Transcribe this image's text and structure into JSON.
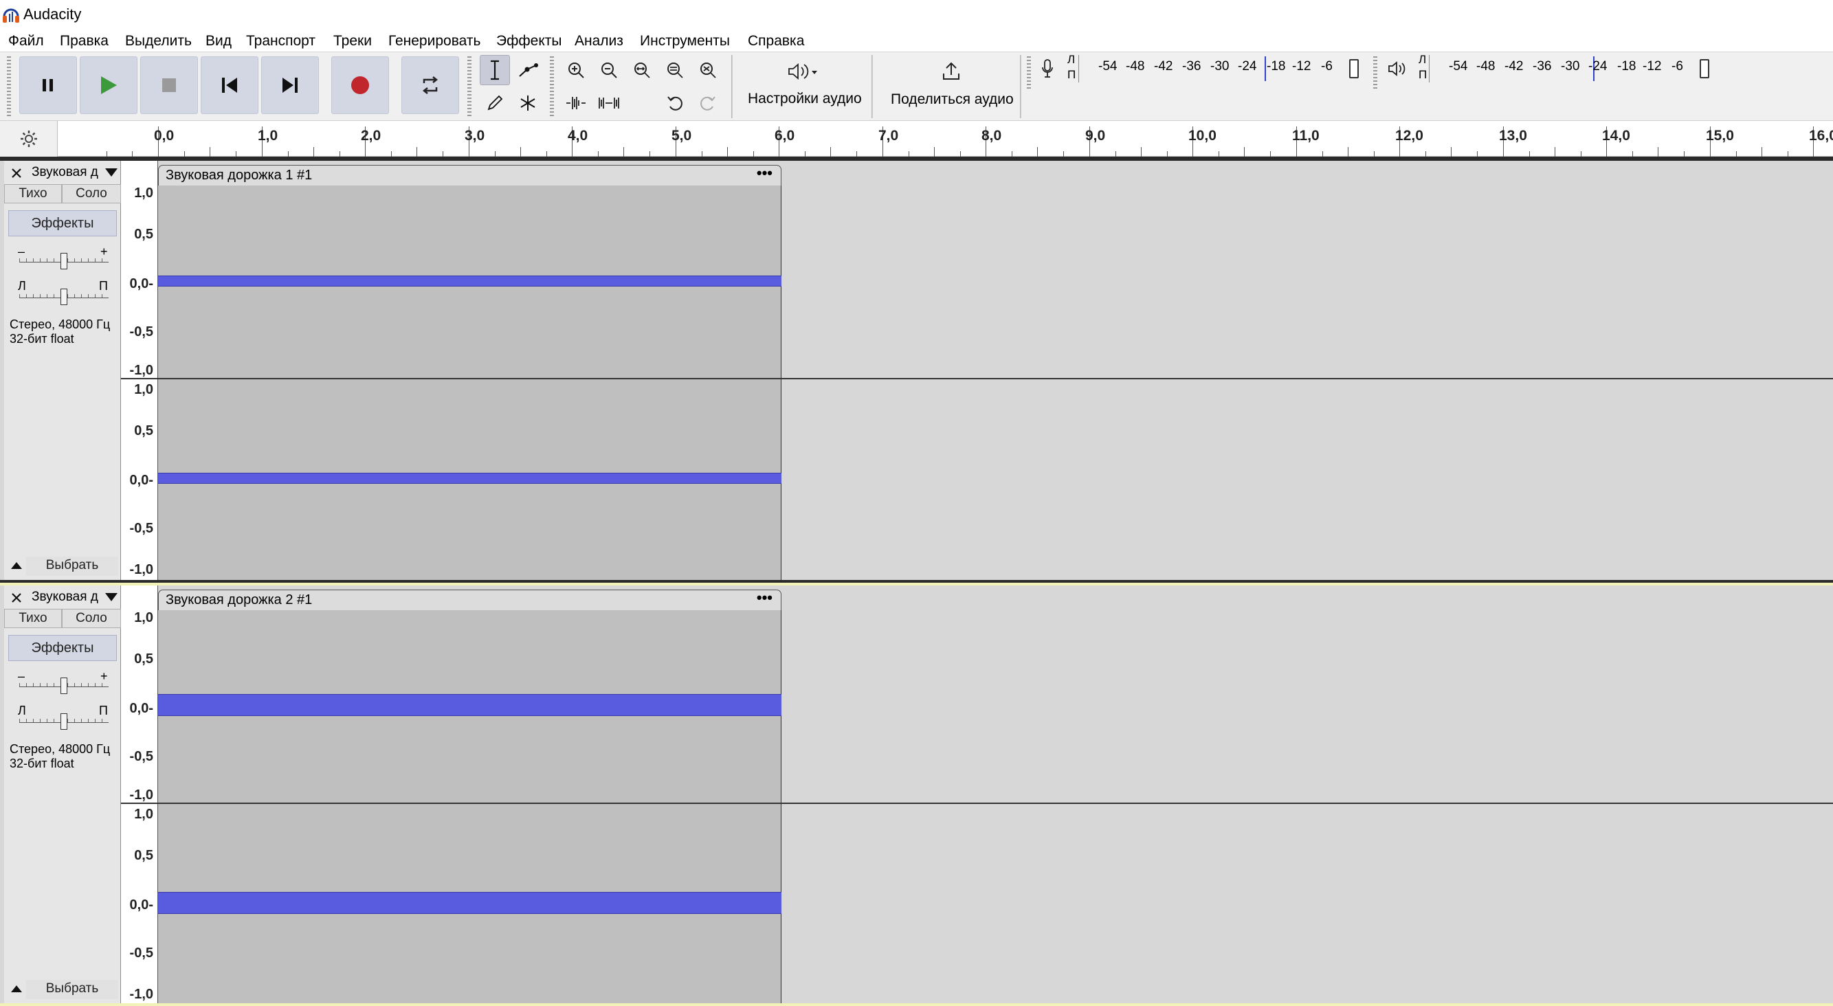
{
  "app": {
    "title": "Audacity"
  },
  "menu": [
    "Файл",
    "Правка",
    "Выделить",
    "Вид",
    "Транспорт",
    "Треки",
    "Генерировать",
    "Эффекты",
    "Анализ",
    "Инструменты",
    "Справка"
  ],
  "toolbar": {
    "audio_setup_label": "Настройки аудио",
    "share_audio_label": "Поделиться аудио",
    "record_meter": {
      "left": "Л",
      "right": "П",
      "scale": [
        "-54",
        "-48",
        "-42",
        "-36",
        "-30",
        "-24",
        "-18",
        "-12",
        "-6"
      ]
    },
    "play_meter": {
      "left": "Л",
      "right": "П",
      "scale": [
        "-54",
        "-48",
        "-42",
        "-36",
        "-30",
        "-24",
        "-18",
        "-12",
        "-6"
      ]
    }
  },
  "ruler": {
    "ticks": [
      "0,0",
      "1,0",
      "2,0",
      "3,0",
      "4,0",
      "5,0",
      "6,0",
      "7,0",
      "8,0",
      "9,0",
      "10,0",
      "11,0",
      "12,0",
      "13,0",
      "14,0",
      "15,0",
      "16,0"
    ]
  },
  "tracks": [
    {
      "name": "Звуковая д",
      "mute": "Тихо",
      "solo": "Соло",
      "effects": "Эффекты",
      "gain_minus": "–",
      "gain_plus": "+",
      "pan_left": "Л",
      "pan_right": "П",
      "format_line1": "Стерео, 48000 Гц",
      "format_line2": "32-бит float",
      "select": "Выбрать",
      "clip_title": "Звуковая дорожка 1 #1",
      "clip_menu": "•••",
      "scale": [
        "1,0",
        "0,5",
        "0,0-",
        "-0,5",
        "-1,0"
      ]
    },
    {
      "name": "Звуковая д",
      "mute": "Тихо",
      "solo": "Соло",
      "effects": "Эффекты",
      "gain_minus": "–",
      "gain_plus": "+",
      "pan_left": "Л",
      "pan_right": "П",
      "format_line1": "Стерео, 48000 Гц",
      "format_line2": "32-бит float",
      "select": "Выбрать",
      "clip_title": "Звуковая дорожка 2 #1",
      "clip_menu": "•••",
      "scale": [
        "1,0",
        "0,5",
        "0,0-",
        "-0,5",
        "-1,0"
      ]
    }
  ],
  "colors": {
    "waveform": "#5a5ce0",
    "record": "#c0262b",
    "play": "#3c9a3c",
    "selected_track_border": "#e8e8a0"
  }
}
